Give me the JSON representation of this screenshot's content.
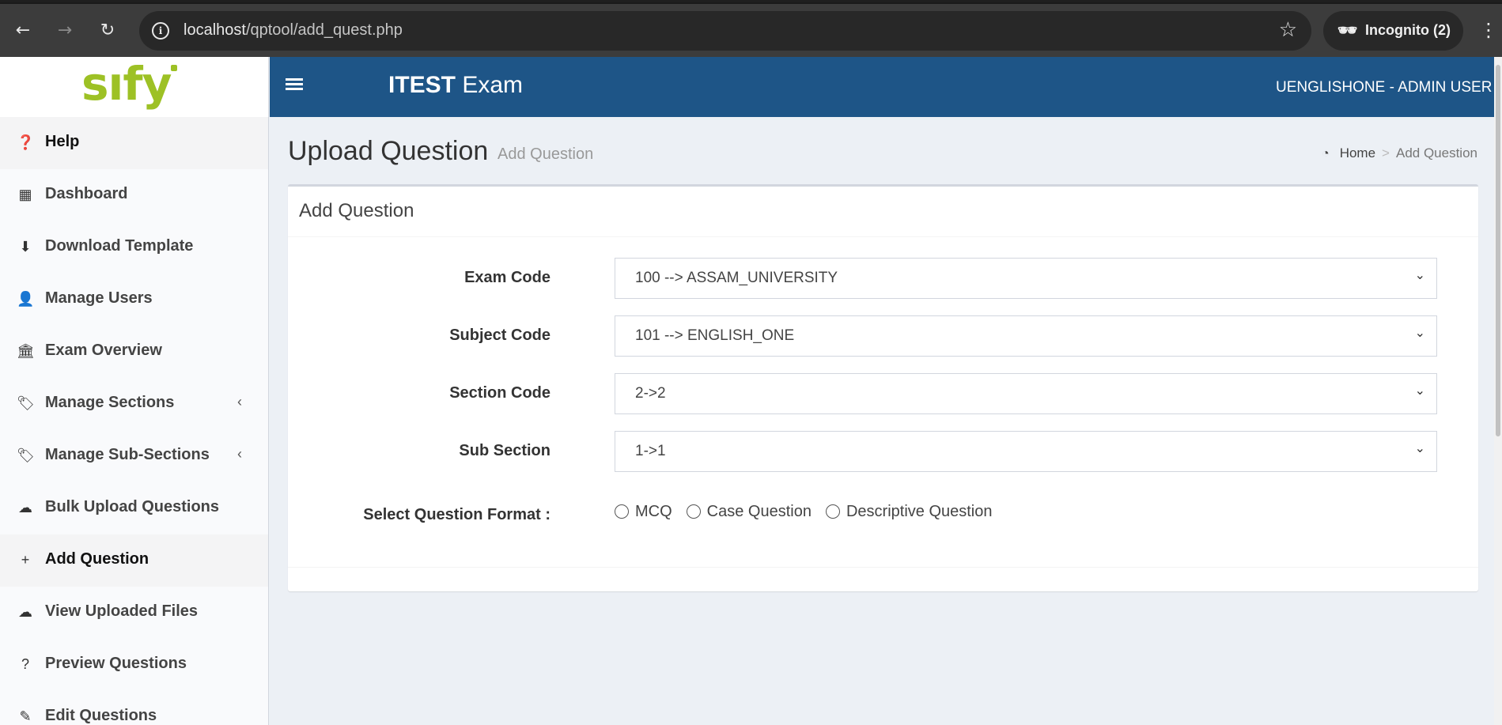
{
  "browser": {
    "url_host": "localhost",
    "url_path": "/qptool/add_quest.php",
    "incognito_label": "Incognito (2)",
    "icons": [
      "back-arrow-icon",
      "forward-arrow-icon",
      "reload-icon",
      "site-info-icon",
      "bookmark-star-icon",
      "incognito-icon",
      "more-menu-icon"
    ]
  },
  "logo": {
    "text": "sıfy"
  },
  "sidebar": {
    "items": [
      {
        "label": "Help",
        "icon": "question-circle-icon",
        "glyph": "❓"
      },
      {
        "label": "Dashboard",
        "icon": "table-icon",
        "glyph": "▦"
      },
      {
        "label": "Download Template",
        "icon": "download-circle-icon",
        "glyph": "⬇"
      },
      {
        "label": "Manage Users",
        "icon": "user-icon",
        "glyph": "👤"
      },
      {
        "label": "Exam Overview",
        "icon": "bank-icon",
        "glyph": "🏛"
      },
      {
        "label": "Manage Sections",
        "icon": "tag-icon",
        "glyph": "🏷",
        "chevron": "‹"
      },
      {
        "label": "Manage Sub-Sections",
        "icon": "tags-icon",
        "glyph": "🏷",
        "chevron": "‹"
      },
      {
        "label": "Bulk Upload Questions",
        "icon": "cloud-upload-icon",
        "glyph": "☁"
      },
      {
        "label": "Add Question",
        "icon": "plus-icon",
        "glyph": "+"
      },
      {
        "label": "View Uploaded Files",
        "icon": "cloud-upload-icon",
        "glyph": "☁"
      },
      {
        "label": "Preview Questions",
        "icon": "question-icon",
        "glyph": "?"
      },
      {
        "label": "Edit Questions",
        "icon": "edit-icon",
        "glyph": "✎"
      }
    ],
    "active_item": "Add Question"
  },
  "header": {
    "brand_bold": "ITEST",
    "brand_rest": " Exam",
    "user": "UENGLISHONE - ADMIN USER"
  },
  "page": {
    "title": "Upload Question",
    "subtitle": "Add Question",
    "breadcrumb": {
      "home": "Home",
      "separator": ">",
      "current": "Add Question"
    }
  },
  "form": {
    "box_title": "Add Question",
    "fields": [
      {
        "label": "Exam Code",
        "value": "100 --> ASSAM_UNIVERSITY"
      },
      {
        "label": "Subject Code",
        "value": "101 --> ENGLISH_ONE"
      },
      {
        "label": "Section Code",
        "value": "2->2"
      },
      {
        "label": "Sub Section",
        "value": "1->1"
      }
    ],
    "format_label": "Select Question Format :",
    "format_options": [
      "MCQ",
      "Case Question",
      "Descriptive Question"
    ]
  },
  "colors": {
    "header_bg": "#1e5587",
    "logo_green": "#9dc125",
    "sidebar_bg": "#f9fafc",
    "content_bg": "#ecf0f5"
  }
}
